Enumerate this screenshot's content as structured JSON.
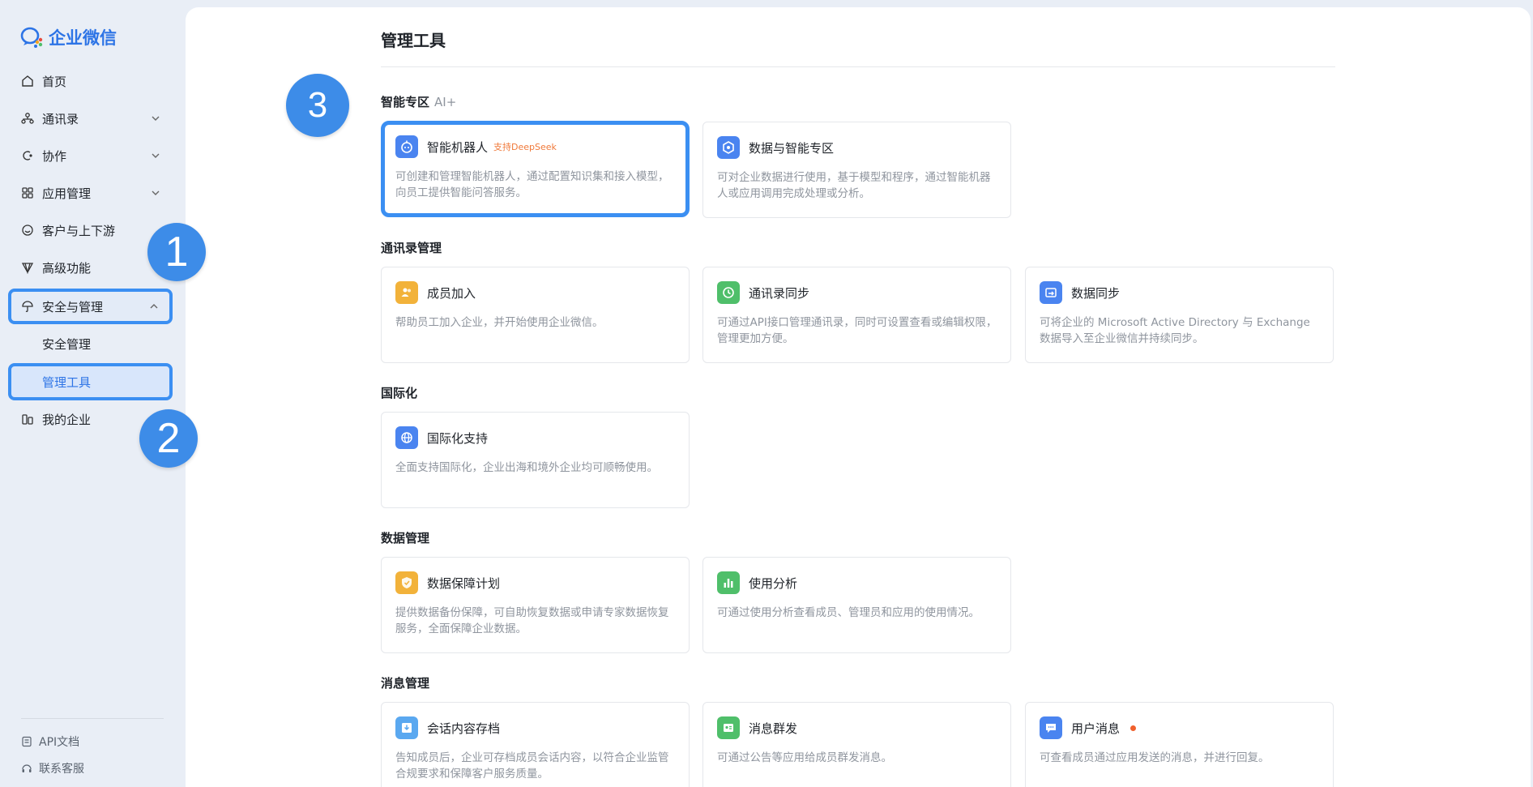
{
  "app": {
    "logo_text": "企业微信",
    "brand_color": "#2d74e6",
    "highlight_color": "#3b8ff2"
  },
  "sidebar": {
    "items": [
      {
        "label": "首页",
        "icon": "home-icon"
      },
      {
        "label": "通讯录",
        "icon": "org-chart-icon",
        "expandable": true
      },
      {
        "label": "协作",
        "icon": "collab-icon",
        "expandable": true
      },
      {
        "label": "应用管理",
        "icon": "grid-icon",
        "expandable": true
      },
      {
        "label": "客户与上下游",
        "icon": "chat-smile-icon",
        "expandable": true
      },
      {
        "label": "高级功能",
        "icon": "diamond-icon"
      },
      {
        "label": "安全与管理",
        "icon": "umbrella-icon",
        "expandable": true,
        "expanded": true
      },
      {
        "label": "安全管理",
        "sub": true
      },
      {
        "label": "管理工具",
        "sub": true,
        "active": true
      },
      {
        "label": "我的企业",
        "icon": "building-icon"
      }
    ],
    "footer": [
      {
        "label": "API文档",
        "icon": "doc-icon"
      },
      {
        "label": "联系客服",
        "icon": "headset-icon"
      }
    ]
  },
  "badges": [
    "1",
    "2",
    "3"
  ],
  "main": {
    "title": "管理工具",
    "sections": [
      {
        "title": "智能专区",
        "suffix": "AI+",
        "cards": [
          {
            "title": "智能机器人",
            "tag": "支持DeepSeek",
            "icon": "robot-icon",
            "color": "#4a84f0",
            "desc": "可创建和管理智能机器人，通过配置知识集和接入模型，向员工提供智能问答服务。"
          },
          {
            "title": "数据与智能专区",
            "icon": "hexagon-icon",
            "color": "#4a84f0",
            "desc": "可对企业数据进行使用，基于模型和程序，通过智能机器人或应用调用完成处理或分析。"
          }
        ]
      },
      {
        "title": "通讯录管理",
        "cards": [
          {
            "title": "成员加入",
            "icon": "members-icon",
            "color": "#f2b23a",
            "desc": "帮助员工加入企业，并开始使用企业微信。"
          },
          {
            "title": "通讯录同步",
            "icon": "sync-icon",
            "color": "#4fbf6a",
            "desc": "可通过API接口管理通讯录，同时可设置查看或编辑权限，管理更加方便。"
          },
          {
            "title": "数据同步",
            "icon": "data-sync-icon",
            "color": "#4a84f0",
            "desc": "可将企业的 Microsoft Active Directory 与 Exchange 数据导入至企业微信并持续同步。"
          }
        ]
      },
      {
        "title": "国际化",
        "cards": [
          {
            "title": "国际化支持",
            "icon": "globe-icon",
            "color": "#4a84f0",
            "desc": "全面支持国际化，企业出海和境外企业均可顺畅使用。"
          }
        ]
      },
      {
        "title": "数据管理",
        "cards": [
          {
            "title": "数据保障计划",
            "icon": "shield-icon",
            "color": "#f2b23a",
            "desc": "提供数据备份保障，可自助恢复数据或申请专家数据恢复服务，全面保障企业数据。"
          },
          {
            "title": "使用分析",
            "icon": "bar-chart-icon",
            "color": "#4fbf6a",
            "desc": "可通过使用分析查看成员、管理员和应用的使用情况。"
          }
        ]
      },
      {
        "title": "消息管理",
        "cards": [
          {
            "title": "会话内容存档",
            "icon": "archive-icon",
            "color": "#5aa8f0",
            "desc": "告知成员后，企业可存档成员会话内容，以符合企业监管合规要求和保障客户服务质量。"
          },
          {
            "title": "消息群发",
            "icon": "broadcast-icon",
            "color": "#4fbf6a",
            "desc": "可通过公告等应用给成员群发消息。"
          },
          {
            "title": "用户消息",
            "icon": "message-icon",
            "color": "#4a84f0",
            "dot": true,
            "desc": "可查看成员通过应用发送的消息，并进行回复。"
          }
        ]
      }
    ]
  }
}
